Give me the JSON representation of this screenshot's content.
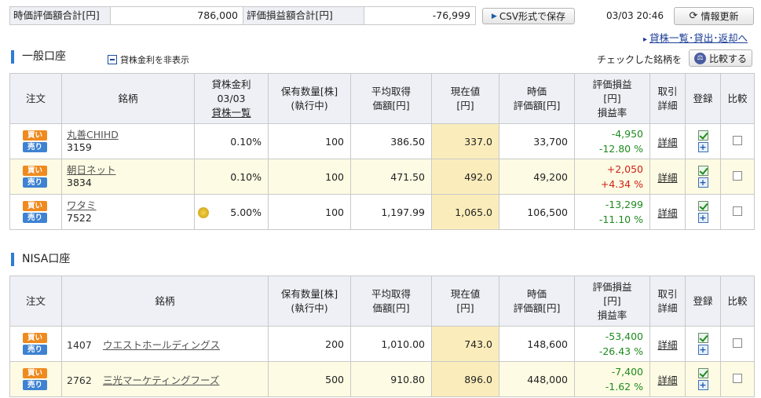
{
  "summary": {
    "market_value_label": "時価評価額合計[円]",
    "market_value": "786,000",
    "pl_label": "評価損益額合計[円]",
    "pl_value": "-76,999",
    "csv_button": "CSV形式で保存",
    "datetime": "03/03 20:46",
    "refresh_button": "情報更新"
  },
  "lend_link": "貸株一覧･貸出･返却へ",
  "general": {
    "title": "一般口座",
    "toggle_label": "貸株金利を非表示",
    "compare_text": "チェックした銘柄を",
    "compare_button": "比較する",
    "headers": {
      "order": "注文",
      "name": "銘柄",
      "lend_rate_line1": "貸株金利",
      "lend_rate_line2": "03/03",
      "lend_rate_link": "貸株一覧",
      "qty_line1": "保有数量[株]",
      "qty_line2": "(執行中)",
      "avg_line1": "平均取得",
      "avg_line2": "価額[円]",
      "price_line1": "現在値",
      "price_line2": "[円]",
      "mv_line1": "時価",
      "mv_line2": "評価額[円]",
      "pl_line1": "評価損益",
      "pl_line2": "[円]",
      "pl_line3": "損益率",
      "detail_line1": "取引",
      "detail_line2": "詳細",
      "register": "登録",
      "compare": "比較"
    },
    "rows": [
      {
        "name": "丸善CHIHD",
        "code": "3159",
        "rate": "0.10%",
        "qty": "100",
        "avg": "386.50",
        "price": "337.0",
        "mv": "33,700",
        "pl": "-4,950",
        "plrate": "-12.80 %",
        "detail": "詳細"
      },
      {
        "name": "朝日ネット",
        "code": "3834",
        "rate": "0.10%",
        "qty": "100",
        "avg": "471.50",
        "price": "492.0",
        "mv": "49,200",
        "pl": "+2,050",
        "plrate": "+4.34 %",
        "detail": "詳細"
      },
      {
        "name": "ワタミ",
        "code": "7522",
        "rate": "5.00%",
        "qty": "100",
        "avg": "1,197.99",
        "price": "1,065.0",
        "mv": "106,500",
        "pl": "-13,299",
        "plrate": "-11.10 %",
        "detail": "詳細"
      }
    ]
  },
  "nisa": {
    "title": "NISA口座",
    "rows": [
      {
        "code": "1407",
        "name": "ウエストホールディングス",
        "qty": "200",
        "avg": "1,010.00",
        "price": "743.0",
        "mv": "148,600",
        "pl": "-53,400",
        "plrate": "-26.43 %",
        "detail": "詳細"
      },
      {
        "code": "2762",
        "name": "三光マーケティングフーズ",
        "qty": "500",
        "avg": "910.80",
        "price": "896.0",
        "mv": "448,000",
        "pl": "-7,400",
        "plrate": "-1.62 %",
        "detail": "詳細"
      }
    ]
  },
  "tags": {
    "buy": "買い",
    "sell": "売り"
  },
  "colors": {
    "positive": "#1e8b1e",
    "negative": "#d0201a",
    "price_bg": "#fbedbb",
    "highlight_row": "#fdfbe3",
    "buy_tag": "#ef8a1f",
    "sell_tag": "#3e82d2"
  }
}
